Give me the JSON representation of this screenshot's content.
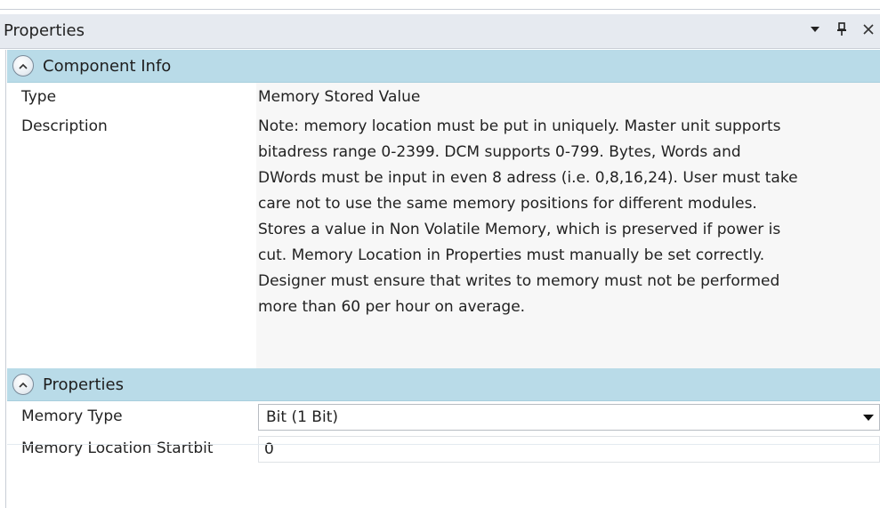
{
  "panel": {
    "title": "Properties"
  },
  "title_controls": {
    "dropdown_icon": "chevron-down-icon",
    "pin_icon": "pin-icon",
    "close_icon": "close-icon"
  },
  "categories": [
    {
      "label": "Component Info",
      "rows": [
        {
          "name": "Type",
          "value": "Memory Stored Value"
        },
        {
          "name": "Description",
          "value_lines": [
            "Note: memory location must be put in uniquely. Master unit supports",
            "bitadress range 0-2399. DCM supports 0-799. Bytes, Words and",
            "DWords must be input in even 8 adress (i.e. 0,8,16,24). User must take",
            "care not to use the same memory positions for different modules.",
            "Stores a value in Non Volatile Memory, which is preserved if power is",
            "cut. Memory Location in Properties must manually be set correctly.",
            "Designer must ensure that writes to memory must not be performed",
            "more than 60 per hour on average."
          ]
        }
      ]
    },
    {
      "label": "Properties",
      "rows": [
        {
          "name": "Memory Type",
          "value": "Bit (1 Bit)"
        },
        {
          "name": "Memory Location Startbit",
          "value": "0"
        }
      ]
    }
  ],
  "colors": {
    "category_bg": "#b9dbe8",
    "title_bar_bg": "#e6eaf0",
    "value_bg": "#f7f7f7"
  }
}
